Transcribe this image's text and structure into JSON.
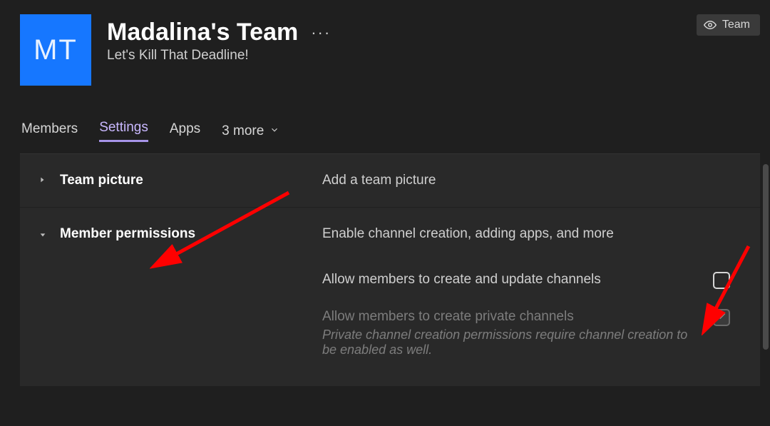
{
  "header": {
    "avatar_initials": "MT",
    "team_name": "Madalina's Team",
    "more_dots": "···",
    "subtitle": "Let's Kill That Deadline!"
  },
  "team_button": {
    "label": "Team"
  },
  "tabs": {
    "members": "Members",
    "settings": "Settings",
    "apps": "Apps",
    "more": "3 more"
  },
  "sections": {
    "team_picture": {
      "title": "Team picture",
      "desc": "Add a team picture"
    },
    "member_permissions": {
      "title": "Member permissions",
      "desc": "Enable channel creation, adding apps, and more",
      "items": [
        {
          "label": "Allow members to create and update channels",
          "checked": false,
          "disabled": false
        },
        {
          "label": "Allow members to create private channels",
          "help": "Private channel creation permissions require channel creation to be enabled as well.",
          "checked": true,
          "disabled": true
        }
      ]
    }
  }
}
